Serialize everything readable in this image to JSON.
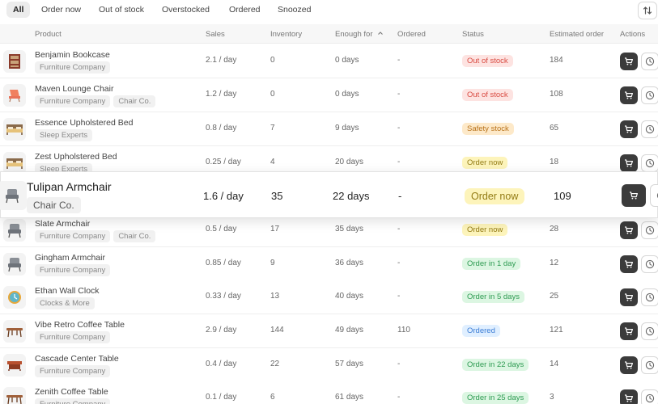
{
  "filters": [
    "All",
    "Order now",
    "Out of stock",
    "Overstocked",
    "Ordered",
    "Snoozed"
  ],
  "columns": {
    "product": "Product",
    "sales": "Sales",
    "inventory": "Inventory",
    "enough_for": "Enough for",
    "ordered": "Ordered",
    "status": "Status",
    "estimated_order": "Estimated order",
    "actions": "Actions"
  },
  "icons": {
    "sort": "sort-arrows-icon",
    "enough_for_sort": "sort-caret-icon",
    "cart": "cart-icon",
    "snooze": "clock-icon"
  },
  "status_colors": {
    "red": "#d94c43",
    "orange": "#b9731b",
    "yellow": "#937b14",
    "green": "#2e9b52",
    "blue": "#3d7ed6"
  },
  "rows": [
    {
      "name": "Benjamin Bookcase",
      "tags": [
        "Furniture Company"
      ],
      "sales": "2.1 / day",
      "inventory": "0",
      "enough_for": "0 days",
      "ordered": "-",
      "status": "Out of stock",
      "status_color": "red",
      "estimated": "184",
      "thumb": "bookcase-icon"
    },
    {
      "name": "Maven Lounge Chair",
      "tags": [
        "Furniture Company",
        "Chair Co."
      ],
      "sales": "1.2 / day",
      "inventory": "0",
      "enough_for": "0 days",
      "ordered": "-",
      "status": "Out of stock",
      "status_color": "red",
      "estimated": "108",
      "thumb": "lounge-chair-icon"
    },
    {
      "name": "Essence Upholstered Bed",
      "tags": [
        "Sleep Experts"
      ],
      "sales": "0.8 / day",
      "inventory": "7",
      "enough_for": "9 days",
      "ordered": "-",
      "status": "Safety stock",
      "status_color": "orange",
      "estimated": "65",
      "thumb": "bed-icon"
    },
    {
      "name": "Zest Upholstered Bed",
      "tags": [
        "Sleep Experts"
      ],
      "sales": "0.25 / day",
      "inventory": "4",
      "enough_for": "20 days",
      "ordered": "-",
      "status": "Order now",
      "status_color": "yellow",
      "estimated": "18",
      "thumb": "bed-icon"
    },
    {
      "name": "Tulipan Armchair",
      "tags": [
        "Chair Co."
      ],
      "sales": "1.6 / day",
      "inventory": "35",
      "enough_for": "22 days",
      "ordered": "-",
      "status": "Order now",
      "status_color": "yellow",
      "estimated": "109",
      "thumb": "armchair-icon",
      "highlight": true
    },
    {
      "name": "Slate Armchair",
      "tags": [
        "Furniture Company",
        "Chair Co."
      ],
      "sales": "0.5  / day",
      "inventory": "17",
      "enough_for": "35 days",
      "ordered": "-",
      "status": "Order now",
      "status_color": "yellow",
      "estimated": "28",
      "thumb": "armchair-icon"
    },
    {
      "name": "Gingham Armchair",
      "tags": [
        "Furniture Company"
      ],
      "sales": "0.85  / day",
      "inventory": "9",
      "enough_for": "36 days",
      "ordered": "-",
      "status": "Order in 1 day",
      "status_color": "green",
      "estimated": "12",
      "thumb": "armchair-icon"
    },
    {
      "name": "Ethan Wall Clock",
      "tags": [
        "Clocks & More"
      ],
      "sales": "0.33 / day",
      "inventory": "13",
      "enough_for": "40 days",
      "ordered": "-",
      "status": "Order in 5 days",
      "status_color": "green",
      "estimated": "25",
      "thumb": "wall-clock-icon"
    },
    {
      "name": "Vibe Retro Coffee Table",
      "tags": [
        "Furniture Company"
      ],
      "sales": "2.9 / day",
      "inventory": "144",
      "enough_for": "49 days",
      "ordered": "110",
      "status": "Ordered",
      "status_color": "blue",
      "estimated": "121",
      "thumb": "coffee-table-icon"
    },
    {
      "name": "Cascade Center Table",
      "tags": [
        "Furniture Company"
      ],
      "sales": "0.4 / day",
      "inventory": "22",
      "enough_for": "57 days",
      "ordered": "-",
      "status": "Order in 22 days",
      "status_color": "green",
      "estimated": "14",
      "thumb": "center-table-icon"
    },
    {
      "name": "Zenith Coffee Table",
      "tags": [
        "Furniture Company"
      ],
      "sales": "0.1 / day",
      "inventory": "6",
      "enough_for": "61 days",
      "ordered": "-",
      "status": "Order in 25 days",
      "status_color": "green",
      "estimated": "3",
      "thumb": "coffee-table-icon"
    }
  ]
}
